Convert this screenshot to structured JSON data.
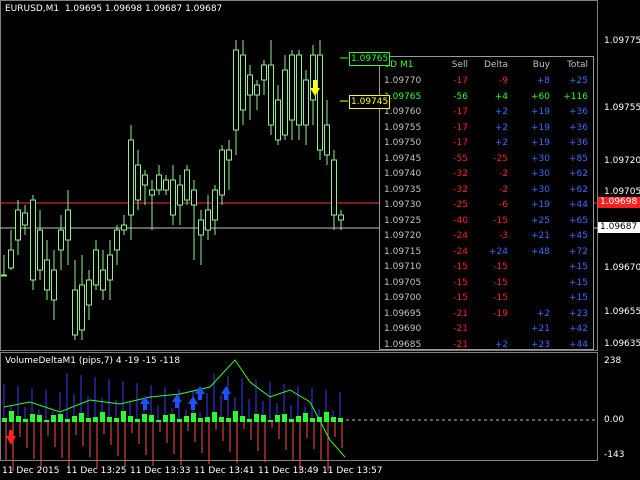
{
  "main_header": "EURUSD,M1  1.09695 1.09698 1.09687 1.09687",
  "sub_header": "VolumeDeltaM1 (pips,7) 4 -19 -15 -118",
  "price_axis": [
    "1.09775",
    "1.09755",
    "1.09720",
    "1.09705",
    "1.09670",
    "1.09655",
    "1.09635"
  ],
  "price_tags": {
    "red": "1.09698",
    "white": "1.09687"
  },
  "sub_axis": [
    "238",
    "0.00",
    "-143"
  ],
  "time_axis": [
    "11 Dec 2015",
    "11 Dec 13:25",
    "11 Dec 13:33",
    "11 Dec 13:41",
    "11 Dec 13:49",
    "11 Dec 13:57"
  ],
  "box_labels": {
    "high": "1.09765",
    "low": "1.09745"
  },
  "table": {
    "headers": [
      "VD M1",
      "Sell",
      "Delta",
      "Buy",
      "Total"
    ],
    "rows": [
      [
        "1.09770",
        "-17",
        "-9",
        "+8",
        "+25"
      ],
      [
        "1.09765",
        "-56",
        "+4",
        "+60",
        "+116"
      ],
      [
        "1.09760",
        "-17",
        "+2",
        "+19",
        "+36"
      ],
      [
        "1.09755",
        "-17",
        "+2",
        "+19",
        "+36"
      ],
      [
        "1.09750",
        "-17",
        "+2",
        "+19",
        "+36"
      ],
      [
        "1.09745",
        "-55",
        "-25",
        "+30",
        "+85"
      ],
      [
        "1.09740",
        "-32",
        "-2",
        "+30",
        "+62"
      ],
      [
        "1.09735",
        "-32",
        "-2",
        "+30",
        "+62"
      ],
      [
        "1.09730",
        "-25",
        "-6",
        "+19",
        "+44"
      ],
      [
        "1.09725",
        "-40",
        "-15",
        "+25",
        "+65"
      ],
      [
        "1.09720",
        "-24",
        "-3",
        "+21",
        "+45"
      ],
      [
        "1.09715",
        "-24",
        "+24",
        "+48",
        "+72"
      ],
      [
        "1.09710",
        "-15",
        "-15",
        "",
        "+15"
      ],
      [
        "1.09705",
        "-15",
        "-15",
        "",
        "+15"
      ],
      [
        "1.09700",
        "-15",
        "-15",
        "",
        "+15"
      ],
      [
        "1.09695",
        "-21",
        "-19",
        "+2",
        "+23"
      ],
      [
        "1.09690",
        "-21",
        "",
        "+21",
        "+42"
      ],
      [
        "1.09685",
        "-21",
        "+2",
        "+23",
        "+44"
      ]
    ],
    "highlight_index": 1
  },
  "colors": {
    "candle": "#90ee90",
    "sell": "#ff2020",
    "buy": "#3a6bff",
    "highlight": "#2aff2a",
    "price_text": "#c0c0c0",
    "grid": "#202020",
    "red_line": "#ff3030",
    "arrow_up": "#1e50ff",
    "arrow_down": "#ff2020",
    "yellow": "#ffff00"
  }
}
